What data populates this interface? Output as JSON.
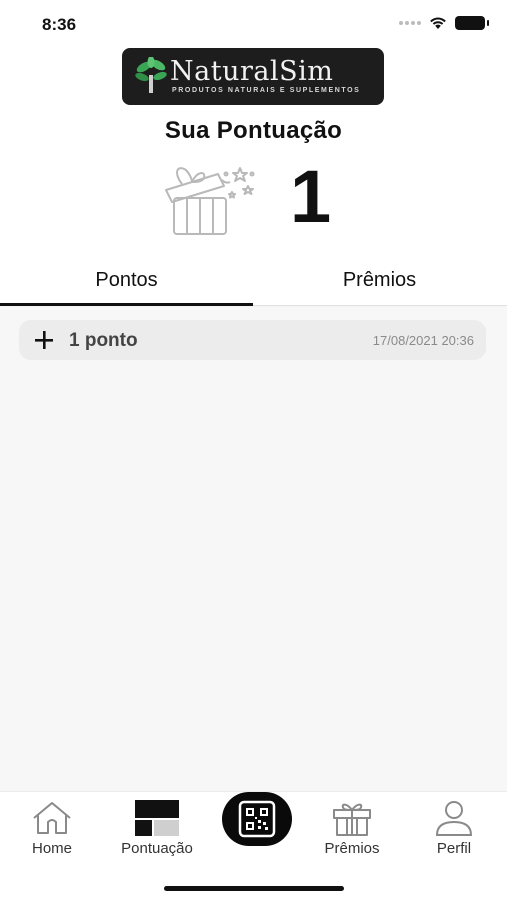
{
  "status_bar": {
    "time": "8:36"
  },
  "brand": {
    "name": "NaturalSim",
    "tagline": "PRODUTOS NATURAIS E SUPLEMENTOS"
  },
  "score": {
    "title": "Sua Pontuação",
    "value": "1"
  },
  "tabs": [
    {
      "label": "Pontos",
      "active": true
    },
    {
      "label": "Prêmios",
      "active": false
    }
  ],
  "points": [
    {
      "label": "1 ponto",
      "date": "17/08/2021 20:36"
    }
  ],
  "nav": {
    "home": "Home",
    "pontuacao": "Pontuação",
    "premios": "Prêmios",
    "perfil": "Perfil"
  },
  "colors": {
    "primary": "#111111",
    "logo_bg": "#1d1d1d",
    "leaf_green": "#3aa655",
    "row_bg": "#ececec",
    "content_bg": "#f7f7f7"
  },
  "icons": [
    "signal-icon",
    "wifi-icon",
    "battery-icon",
    "leaf-icon",
    "gift-icon",
    "plus-icon",
    "home-icon",
    "pontuacao-icon",
    "qr-code-icon",
    "gift-nav-icon",
    "user-icon"
  ]
}
